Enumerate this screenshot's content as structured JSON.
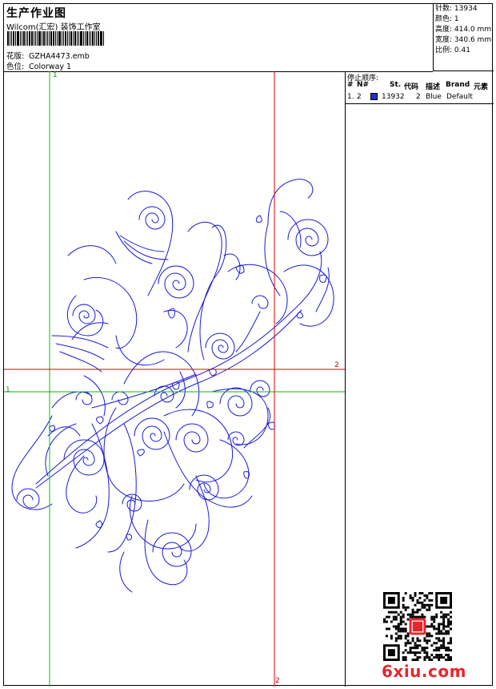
{
  "header": {
    "title": "生产作业图",
    "subtitle": "Wilcom(汇宏) 装饰工作室",
    "pattern_label": "花版:",
    "pattern_value": "GZHA4473.emb",
    "colorway_label": "色位:",
    "colorway_value": "Colorway 1"
  },
  "stats": [
    {
      "label": "针数:",
      "value": "13934"
    },
    {
      "label": "颜色:",
      "value": "1"
    },
    {
      "label": "高度:",
      "value": "414.0 mm"
    },
    {
      "label": "宽度:",
      "value": "340.6 mm"
    },
    {
      "label": "比例:",
      "value": "0.41"
    }
  ],
  "stop_sequence": {
    "caption": "停止顺序:",
    "columns": [
      "#",
      "N#",
      "St.",
      "代码",
      "描述",
      "Brand",
      "元素"
    ],
    "rows": [
      {
        "index": "1.",
        "needle": "2",
        "color": "#1f2fd0",
        "stitches": "13932",
        "code": "2",
        "description": "Blue",
        "brand": "Default"
      }
    ]
  },
  "guides": {
    "green_label_1": "1",
    "green_label_2": "1",
    "red_label_1": "2",
    "red_label_2": "2"
  },
  "colors": {
    "thread": "#1a1ad6",
    "guide_green": "#00c000",
    "guide_red": "#e00000",
    "watermark": "#e6262b"
  },
  "watermark": "6xiu.com"
}
